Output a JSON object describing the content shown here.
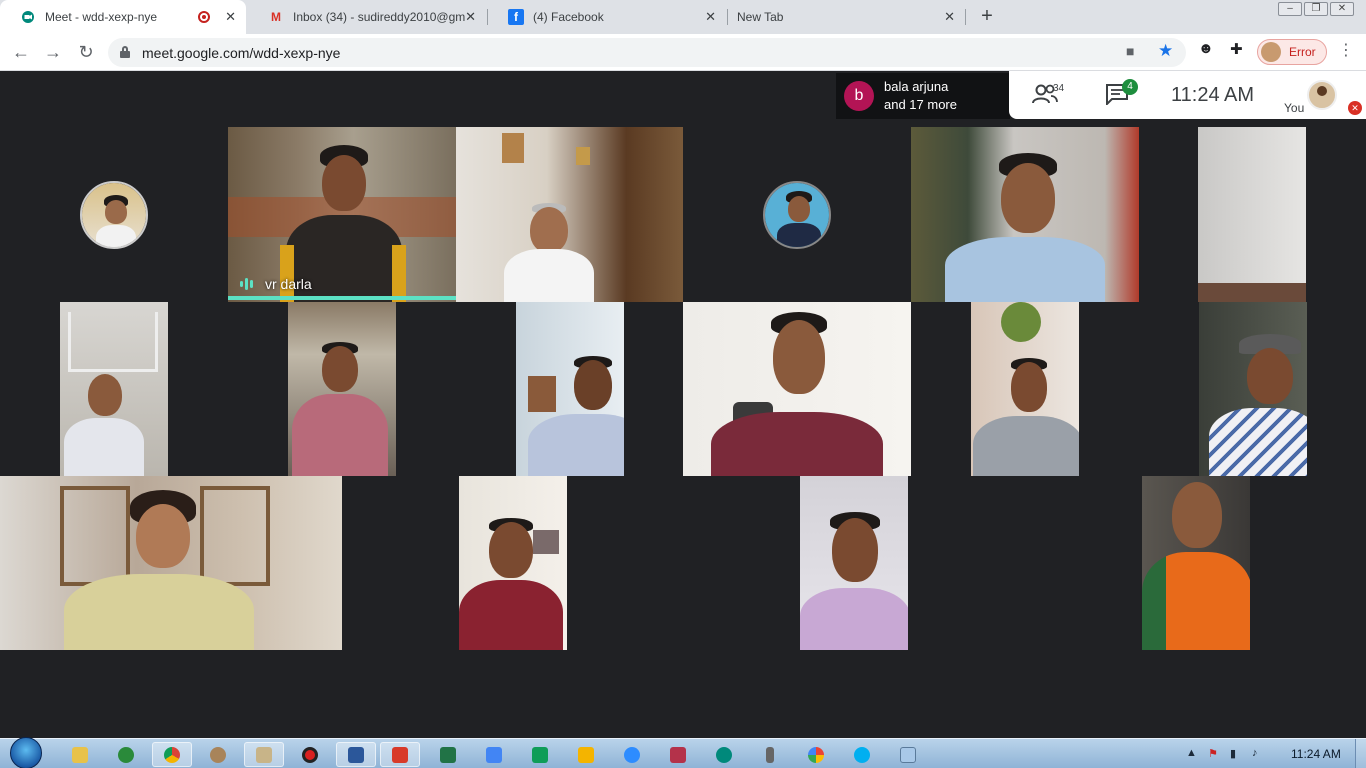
{
  "browser": {
    "tabs": [
      {
        "title": "Meet - wdd-xexp-nye",
        "icon": "google-meet-icon",
        "active": true,
        "recording": true
      },
      {
        "title": "Inbox (34) - sudireddy2010@gm",
        "icon": "gmail-icon",
        "active": false
      },
      {
        "title": "(4) Facebook",
        "icon": "facebook-icon",
        "active": false
      },
      {
        "title": "New Tab",
        "icon": "none",
        "active": false
      }
    ],
    "url": "meet.google.com/wdd-xexp-nye",
    "profile_status": "Error"
  },
  "meet": {
    "speakers_initial": "b",
    "speakers_line1": "bala arjuna",
    "speakers_line2": "and 17 more",
    "participant_count": "34",
    "chat_unread": "4",
    "clock": "11:24  AM",
    "self_label": "You",
    "active_speaker_name": "vr darla"
  },
  "colors": {
    "meet_bg": "#202124",
    "speaking_accent": "#5ce1c4",
    "chat_badge": "#1e8e3e",
    "avatar_b": "#b31455",
    "error_text": "#c5221f"
  },
  "taskbar": {
    "time": "11:24 AM",
    "apps": [
      "file-explorer-icon",
      "recycle-icon",
      "chrome-icon",
      "paint-icon",
      "tools-icon",
      "record-icon",
      "word-icon",
      "acrobat-icon",
      "excel-icon",
      "docs-icon",
      "sheets-icon",
      "slides-icon",
      "zoom-icon",
      "pdf-icon",
      "meet-icon",
      "mic-icon",
      "photos-icon",
      "skype-icon",
      "notepad-icon"
    ]
  }
}
